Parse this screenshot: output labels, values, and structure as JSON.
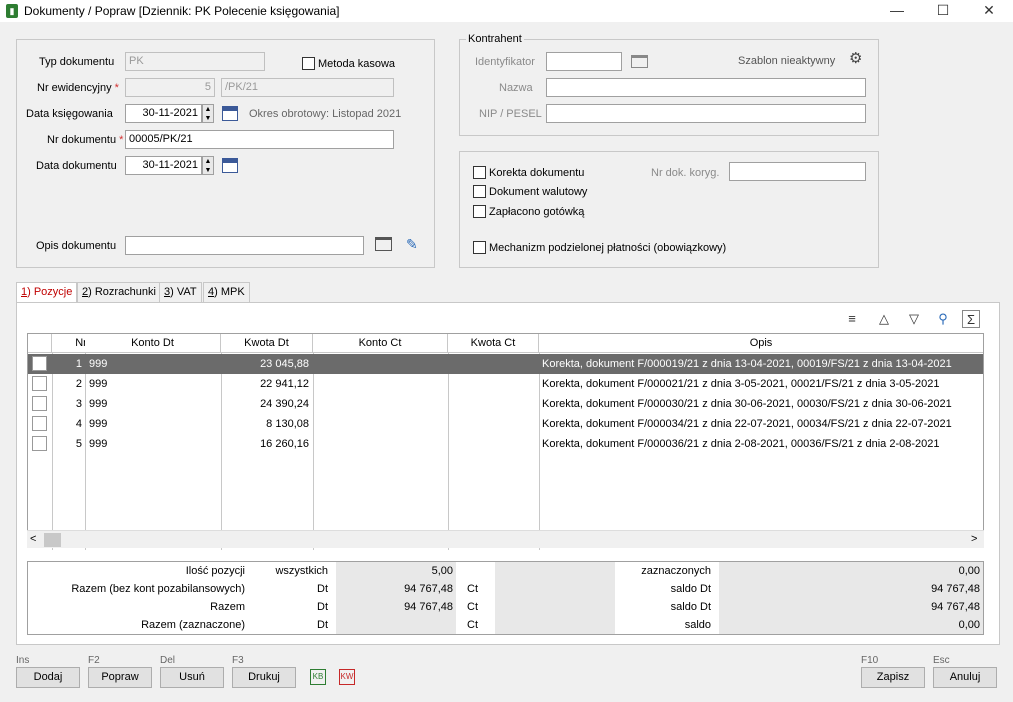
{
  "window": {
    "title": "Dokumenty / Popraw [Dziennik: PK  Polecenie księgowania]",
    "minimize": "—",
    "maximize": "☐",
    "close": "✕"
  },
  "form": {
    "typ_label": "Typ dokumentu",
    "typ_value": "PK",
    "metoda_kasowa_label": "Metoda kasowa",
    "nr_ewid_label": "Nr ewidencyjny",
    "nr_ewid_value": "5",
    "nr_ewid_suffix": "/PK/21",
    "data_ksieg_label": "Data księgowania",
    "data_ksieg_value": "30-11-2021",
    "okres_text": "Okres obrotowy: Listopad 2021",
    "nr_dok_label": "Nr dokumentu",
    "nr_dok_value": "00005/PK/21",
    "data_dok_label": "Data dokumentu",
    "data_dok_value": "30-11-2021",
    "opis_label": "Opis dokumentu",
    "opis_value": ""
  },
  "kontrahent": {
    "group_label": "Kontrahent",
    "identyfikator_label": "Identyfikator",
    "nazwa_label": "Nazwa",
    "nip_label": "NIP / PESEL",
    "szablon_text": "Szablon nieaktywny"
  },
  "options": {
    "korekta_label": "Korekta dokumentu",
    "nr_dok_koryg_label": "Nr dok. koryg.",
    "walutowy_label": "Dokument walutowy",
    "gotowka_label": "Zapłacono gotówką",
    "split_label": "Mechanizm podzielonej płatności (obowiązkowy)"
  },
  "tabs": [
    {
      "key": "1",
      "label": ") Pozycje"
    },
    {
      "key": "2",
      "label": ") Rozrachunki"
    },
    {
      "key": "3",
      "label": ") VAT"
    },
    {
      "key": "4",
      "label": ") MPK"
    }
  ],
  "grid": {
    "headers": [
      "Nr",
      "Konto Dt",
      "Kwota Dt",
      "Konto Ct",
      "Kwota Ct",
      "Opis"
    ],
    "rows": [
      {
        "nr": "1",
        "konto_dt": "999",
        "kwota_dt": "23 045,88",
        "konto_ct": "",
        "kwota_ct": "",
        "opis": "Korekta, dokument F/000019/21 z dnia 13-04-2021, 00019/FS/21 z dnia 13-04-2021"
      },
      {
        "nr": "2",
        "konto_dt": "999",
        "kwota_dt": "22 941,12",
        "konto_ct": "",
        "kwota_ct": "",
        "opis": "Korekta, dokument F/000021/21 z dnia 3-05-2021, 00021/FS/21 z dnia 3-05-2021"
      },
      {
        "nr": "3",
        "konto_dt": "999",
        "kwota_dt": "24 390,24",
        "konto_ct": "",
        "kwota_ct": "",
        "opis": "Korekta, dokument F/000030/21 z dnia 30-06-2021, 00030/FS/21 z dnia 30-06-2021"
      },
      {
        "nr": "4",
        "konto_dt": "999",
        "kwota_dt": "8 130,08",
        "konto_ct": "",
        "kwota_ct": "",
        "opis": "Korekta, dokument F/000034/21 z dnia 22-07-2021, 00034/FS/21 z dnia 22-07-2021"
      },
      {
        "nr": "5",
        "konto_dt": "999",
        "kwota_dt": "16 260,16",
        "konto_ct": "",
        "kwota_ct": "",
        "opis": "Korekta, dokument F/000036/21 z dnia 2-08-2021, 00036/FS/21 z dnia 2-08-2021"
      }
    ]
  },
  "summary": {
    "r1": {
      "label": "Ilość pozycji",
      "sub": "wszystkich",
      "val": "5,00",
      "right_label": "zaznaczonych",
      "right_val": "0,00"
    },
    "r2": {
      "label": "Razem (bez kont pozabilansowych)",
      "dt": "Dt",
      "dt_val": "94 767,48",
      "ct": "Ct",
      "right_label": "saldo Dt",
      "right_val": "94 767,48"
    },
    "r3": {
      "label": "Razem",
      "dt": "Dt",
      "dt_val": "94 767,48",
      "ct": "Ct",
      "right_label": "saldo Dt",
      "right_val": "94 767,48"
    },
    "r4": {
      "label": "Razem (zaznaczone)",
      "dt": "Dt",
      "ct": "Ct",
      "right_label": "saldo",
      "right_val": "0,00"
    }
  },
  "buttons": {
    "dodaj": {
      "key": "Ins",
      "label": "Dodaj"
    },
    "popraw": {
      "key": "F2",
      "label": "Popraw"
    },
    "usun": {
      "key": "Del",
      "label": "Usuń"
    },
    "drukuj": {
      "key": "F3",
      "label": "Drukuj"
    },
    "zapisz": {
      "key": "F10",
      "label": "Zapisz"
    },
    "anuluj": {
      "key": "Esc",
      "label": "Anuluj"
    }
  }
}
